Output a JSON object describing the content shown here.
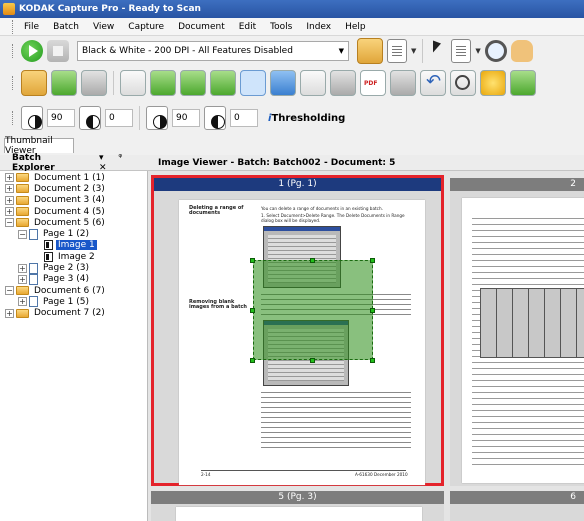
{
  "window": {
    "title": "KODAK Capture Pro - Ready to Scan"
  },
  "menu": [
    "File",
    "Batch",
    "View",
    "Capture",
    "Document",
    "Edit",
    "Tools",
    "Index",
    "Help"
  ],
  "toolbar": {
    "profile_value": "Black & White - 200 DPI - All Features Disabled"
  },
  "adjust": {
    "brightness_bw": "90",
    "contrast_bw": "0",
    "brightness_color": "90",
    "contrast_color": "0",
    "ithresholding_prefix": "i",
    "ithresholding_label": "Thresholding"
  },
  "tabs": {
    "thumbnail_viewer": "Thumbnail Viewer"
  },
  "explorer": {
    "title": "Batch Explorer",
    "controls": "▾ ᵠ ✕",
    "tree": [
      {
        "label": "Document 1 (1)"
      },
      {
        "label": "Document 2 (3)"
      },
      {
        "label": "Document 3 (4)"
      },
      {
        "label": "Document 4 (5)"
      },
      {
        "label": "Document 5 (6)"
      },
      {
        "label": "Page 1 (2)"
      },
      {
        "label": "Image 1"
      },
      {
        "label": "Image 2"
      },
      {
        "label": "Page 2 (3)"
      },
      {
        "label": "Page 3 (4)"
      },
      {
        "label": "Document 6 (7)"
      },
      {
        "label": "Page 1 (5)"
      },
      {
        "label": "Document 7 (2)"
      }
    ]
  },
  "viewer": {
    "title": "Image Viewer - Batch: Batch002 - Document: 5",
    "captions": [
      "1 (Pg. 1)",
      "2",
      "5 (Pg. 3)",
      "6"
    ]
  },
  "page": {
    "heading1": "Deleting a range of documents",
    "heading2": "Removing blank images from a batch",
    "footer_left": "2-14",
    "footer_right": "A-61630  December 2010",
    "intro": "You can delete a range of documents in an existing batch.",
    "step1": "1. Select Document>Delete Range. The Delete Documents in Range dialog box will be displayed."
  },
  "colors": {
    "title_bg": "#2854a3",
    "selected_frame": "#e4232b",
    "caption_active": "#1d3a7e",
    "selection_overlay": "#288c14",
    "tree_selected": "#1857c9"
  }
}
